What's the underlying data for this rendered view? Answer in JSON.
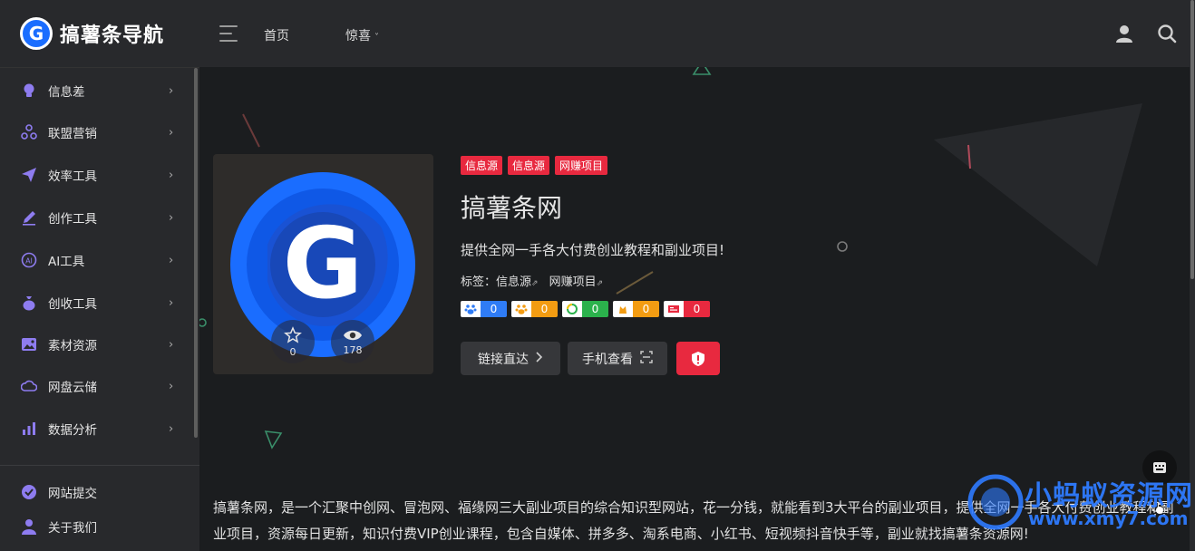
{
  "header": {
    "logo_letter": "G",
    "title": "搞薯条导航",
    "nav": [
      {
        "label": "首页"
      },
      {
        "label": "惊喜",
        "chevron": "˅"
      }
    ],
    "icons": [
      "user-icon",
      "search-icon"
    ]
  },
  "sidebar": {
    "items": [
      {
        "label": "信息差",
        "icon": "lightbulb-icon"
      },
      {
        "label": "联盟营销",
        "icon": "network-icon"
      },
      {
        "label": "效率工具",
        "icon": "paper-plane-icon"
      },
      {
        "label": "创作工具",
        "icon": "pencil-icon"
      },
      {
        "label": "AI工具",
        "icon": "ai-icon"
      },
      {
        "label": "创收工具",
        "icon": "money-bag-icon"
      },
      {
        "label": "素材资源",
        "icon": "image-icon"
      },
      {
        "label": "网盘云储",
        "icon": "cloud-icon"
      },
      {
        "label": "数据分析",
        "icon": "bar-chart-icon"
      }
    ],
    "bottom": [
      {
        "label": "网站提交",
        "icon": "check-circle-icon"
      },
      {
        "label": "关于我们",
        "icon": "person-icon"
      }
    ],
    "arrow": "›"
  },
  "site": {
    "tags": [
      "信息源",
      "信息源",
      "网赚项目"
    ],
    "title": "搞薯条网",
    "description": "提供全网一手各大付费创业教程和副业项目!",
    "labels_prefix": "标签：",
    "labels": [
      "信息源",
      "网赚项目"
    ],
    "favorites": "0",
    "views": "178",
    "seo": [
      {
        "icon": "baidu-paw-icon",
        "value": "0",
        "color": "#2f7cf6"
      },
      {
        "icon": "sogou-paw-icon",
        "value": "0",
        "color": "#f39c12"
      },
      {
        "icon": "360-ring-icon",
        "value": "0",
        "color": "#2bb24c"
      },
      {
        "icon": "shenma-icon",
        "value": "0",
        "color": "#f39c12"
      },
      {
        "icon": "toutiao-icon",
        "value": "0",
        "color": "#e8293f"
      }
    ],
    "buttons": {
      "visit": "链接直达",
      "mobile": "手机查看"
    }
  },
  "article": "搞薯条网，是一个汇聚中创网、冒泡网、福缘网三大副业项目的综合知识型网站，花一分钱，就能看到3大平台的副业项目，提供全网一手各大付费创业教程和副业项目，资源每日更新，知识付费VIP创业课程，包含自媒体、拼多多、淘系电商、小红书、短视频抖音快手等，副业就找搞薯条资源网!",
  "watermark": {
    "text": "小蚂蚁资源网",
    "url": "www.xmy7.com"
  },
  "colors": {
    "accent": "#e8293f",
    "brand": "#1a6dff",
    "bg": "#1b1d1f",
    "panel": "#28292c"
  }
}
